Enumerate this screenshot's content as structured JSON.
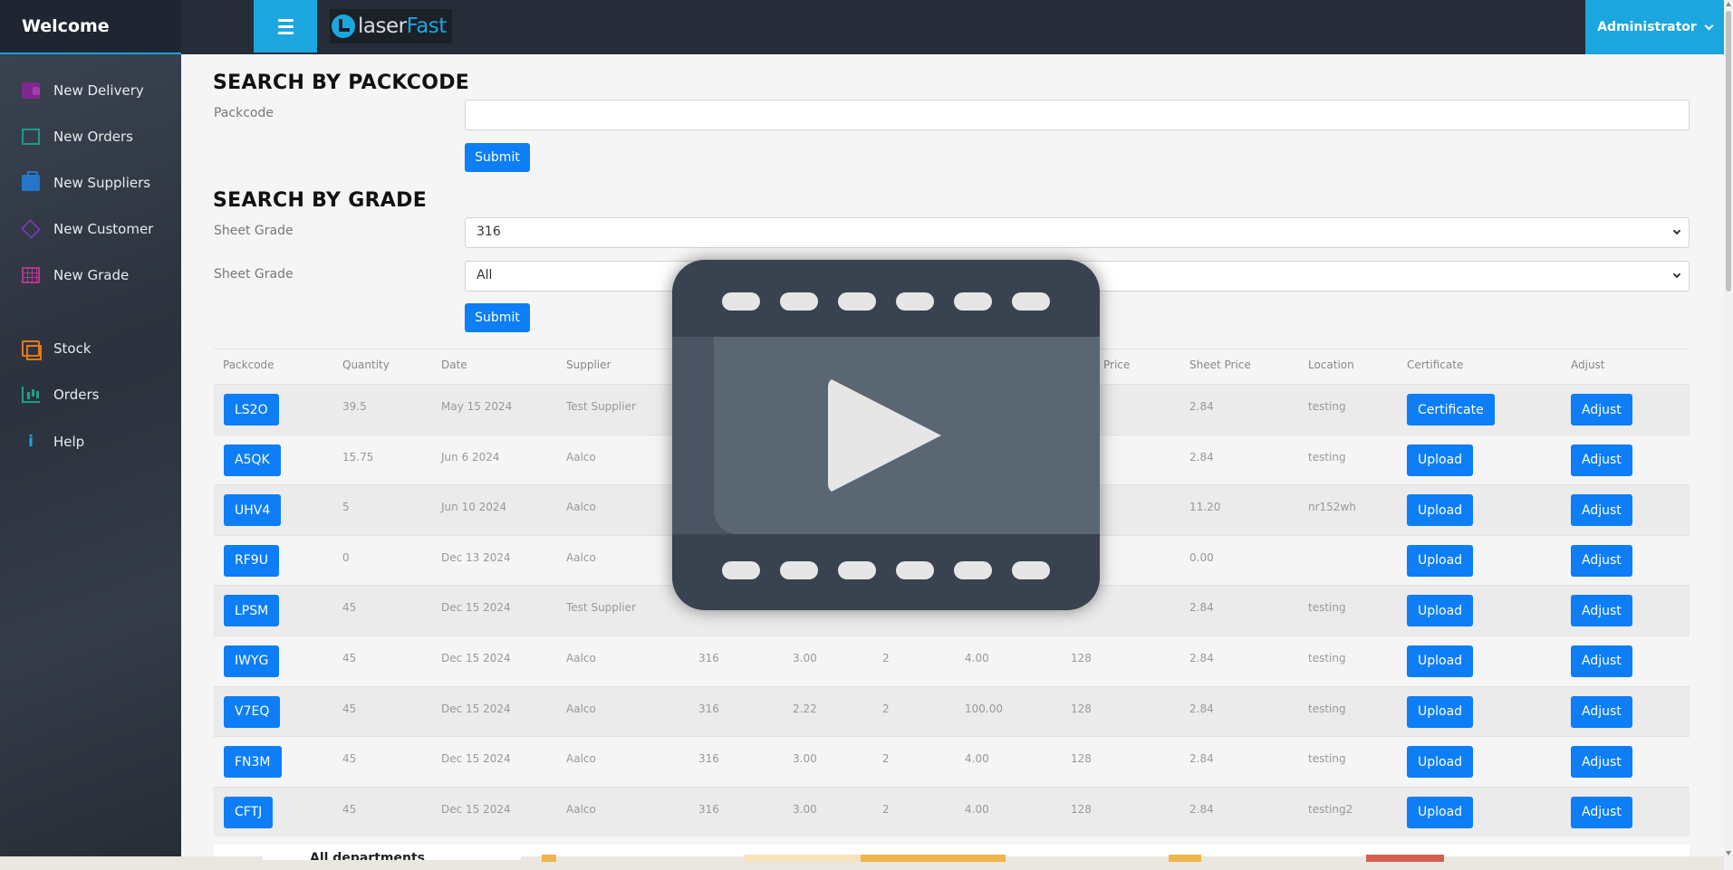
{
  "header": {
    "welcome": "Welcome",
    "logo_text_a": "laser",
    "logo_text_b": "Fast",
    "user": "Administrator"
  },
  "sidebar": {
    "items": [
      {
        "label": "New Delivery",
        "icon": "truck-icon"
      },
      {
        "label": "New Orders",
        "icon": "orders-icon"
      },
      {
        "label": "New Suppliers",
        "icon": "briefcase-icon"
      },
      {
        "label": "New Customer",
        "icon": "diamond-icon"
      },
      {
        "label": "New Grade",
        "icon": "grid-icon"
      },
      {
        "label": "Stock",
        "icon": "copy-icon"
      },
      {
        "label": "Orders",
        "icon": "bar-chart-icon"
      },
      {
        "label": "Help",
        "icon": "info-icon"
      }
    ]
  },
  "packcode_search": {
    "title": "SEARCH BY PACKCODE",
    "label": "Packcode",
    "value": "",
    "submit": "Submit"
  },
  "grade_search": {
    "title": "SEARCH BY GRADE",
    "label1": "Sheet Grade",
    "value1": "316",
    "label2": "Sheet Grade",
    "value2": "All",
    "submit": "Submit"
  },
  "table": {
    "headers": [
      "Packcode",
      "Quantity",
      "Date",
      "Supplier",
      "Price",
      "Sheet Price",
      "Location",
      "Certificate",
      "Adjust"
    ],
    "rows": [
      {
        "packcode": "LS2O",
        "quantity": "39.5",
        "date": "May 15 2024",
        "supplier": "Test Supplier",
        "grade": "",
        "thickness": "",
        "qty2": "",
        "width": "",
        "length": "",
        "sheet_price": "2.84",
        "location": "testing",
        "cert": "Certificate",
        "adjust": "Adjust"
      },
      {
        "packcode": "A5QK",
        "quantity": "15.75",
        "date": "Jun 6 2024",
        "supplier": "Aalco",
        "grade": "",
        "thickness": "",
        "qty2": "",
        "width": "",
        "length": "",
        "sheet_price": "2.84",
        "location": "testing",
        "cert": "Upload",
        "adjust": "Adjust"
      },
      {
        "packcode": "UHV4",
        "quantity": "5",
        "date": "Jun 10 2024",
        "supplier": "Aalco",
        "grade": "",
        "thickness": "",
        "qty2": "",
        "width": "",
        "length": "",
        "sheet_price": "11.20",
        "location": "nr152wh",
        "cert": "Upload",
        "adjust": "Adjust"
      },
      {
        "packcode": "RF9U",
        "quantity": "0",
        "date": "Dec 13 2024",
        "supplier": "Aalco",
        "grade": "",
        "thickness": "",
        "qty2": "",
        "width": "",
        "length": "",
        "sheet_price": "0.00",
        "location": "",
        "cert": "Upload",
        "adjust": "Adjust"
      },
      {
        "packcode": "LPSM",
        "quantity": "45",
        "date": "Dec 15 2024",
        "supplier": "Test Supplier",
        "grade": "",
        "thickness": "",
        "qty2": "",
        "width": "",
        "length": "",
        "sheet_price": "2.84",
        "location": "testing",
        "cert": "Upload",
        "adjust": "Adjust"
      },
      {
        "packcode": "IWYG",
        "quantity": "45",
        "date": "Dec 15 2024",
        "supplier": "Aalco",
        "grade": "316",
        "thickness": "3.00",
        "qty2": "2",
        "width": "4.00",
        "length": "128",
        "sheet_price": "2.84",
        "location": "testing",
        "cert": "Upload",
        "adjust": "Adjust"
      },
      {
        "packcode": "V7EQ",
        "quantity": "45",
        "date": "Dec 15 2024",
        "supplier": "Aalco",
        "grade": "316",
        "thickness": "2.22",
        "qty2": "2",
        "width": "100.00",
        "length": "128",
        "sheet_price": "2.84",
        "location": "testing",
        "cert": "Upload",
        "adjust": "Adjust"
      },
      {
        "packcode": "FN3M",
        "quantity": "45",
        "date": "Dec 15 2024",
        "supplier": "Aalco",
        "grade": "316",
        "thickness": "3.00",
        "qty2": "2",
        "width": "4.00",
        "length": "128",
        "sheet_price": "2.84",
        "location": "testing",
        "cert": "Upload",
        "adjust": "Adjust"
      },
      {
        "packcode": "CFTJ",
        "quantity": "45",
        "date": "Dec 15 2024",
        "supplier": "Aalco",
        "grade": "316",
        "thickness": "3.00",
        "qty2": "2",
        "width": "4.00",
        "length": "128",
        "sheet_price": "2.84",
        "location": "testing2",
        "cert": "Upload",
        "adjust": "Adjust"
      }
    ]
  },
  "bottom": {
    "dept_label": "All departments"
  },
  "colors": {
    "accent": "#1ca6e0",
    "button": "#0d7ef6",
    "topbar": "#262d38"
  }
}
